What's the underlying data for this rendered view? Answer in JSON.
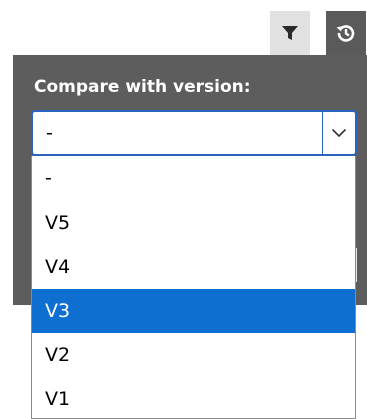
{
  "toolbar": {
    "filter_icon": "filter-icon",
    "history_icon": "history-icon"
  },
  "panel": {
    "label": "Compare with version:"
  },
  "select": {
    "value": "-",
    "arrow_icon": "chevron-down-icon"
  },
  "dropdown": {
    "options": [
      "-",
      "V5",
      "V4",
      "V3",
      "V2",
      "V1"
    ],
    "highlighted": "V3"
  },
  "colors": {
    "panel_bg": "#5d5d5d",
    "highlight": "#0f6fd1",
    "focus_border": "#2b64c0"
  }
}
